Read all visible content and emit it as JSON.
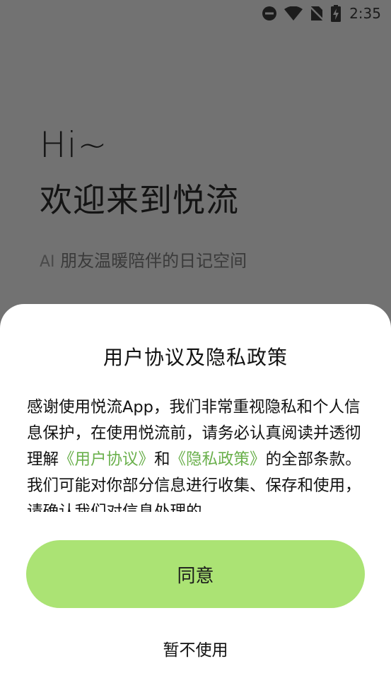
{
  "status_bar": {
    "time": "2:35",
    "icons": [
      "do-not-disturb-icon",
      "wifi-icon",
      "no-sim-icon",
      "battery-charging-icon"
    ]
  },
  "welcome": {
    "greeting": "Hi~",
    "title": "欢迎来到悦流",
    "tagline_prefix": "AI",
    "tagline": " 朋友温暖陪伴的日记空间"
  },
  "dialog": {
    "title": "用户协议及隐私政策",
    "body_part1": "感谢使用悦流App，我们非常重视隐私和个人信息保护，在使用悦流前，请务必认真阅读并透彻理解",
    "link_user_agreement": "《用户协议》",
    "body_and": "和",
    "link_privacy_policy": "《隐私政策》",
    "body_part2": "的全部条款。我们可能对你部分信息进行收集、保存和使用，请确认我们对信息处理的",
    "agree_label": "同意",
    "decline_label": "暂不使用"
  },
  "colors": {
    "overlay": "#727272",
    "accent_button": "#abe374",
    "link": "#6ab04c"
  }
}
